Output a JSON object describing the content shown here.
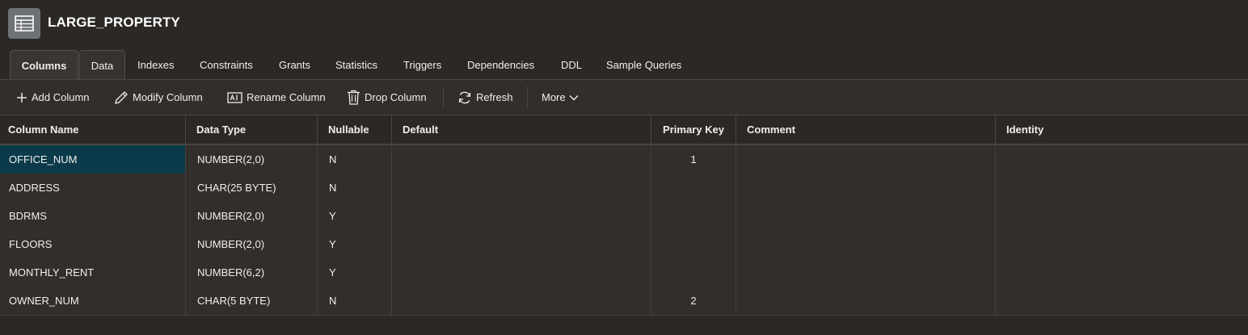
{
  "header": {
    "title": "LARGE_PROPERTY",
    "icon": "table-icon"
  },
  "tabs": [
    {
      "label": "Columns",
      "active": true
    },
    {
      "label": "Data"
    },
    {
      "label": "Indexes"
    },
    {
      "label": "Constraints"
    },
    {
      "label": "Grants"
    },
    {
      "label": "Statistics"
    },
    {
      "label": "Triggers"
    },
    {
      "label": "Dependencies"
    },
    {
      "label": "DDL"
    },
    {
      "label": "Sample Queries"
    }
  ],
  "toolbar": {
    "add_column": "Add Column",
    "modify_column": "Modify Column",
    "rename_column": "Rename Column",
    "drop_column": "Drop Column",
    "refresh": "Refresh",
    "more": "More"
  },
  "grid": {
    "headers": [
      "Column Name",
      "Data Type",
      "Nullable",
      "Default",
      "Primary Key",
      "Comment",
      "Identity"
    ],
    "rows": [
      [
        "OFFICE_NUM",
        "NUMBER(2,0)",
        "N",
        "",
        "1",
        "",
        ""
      ],
      [
        "ADDRESS",
        "CHAR(25 BYTE)",
        "N",
        "",
        "",
        "",
        ""
      ],
      [
        "BDRMS",
        "NUMBER(2,0)",
        "Y",
        "",
        "",
        "",
        ""
      ],
      [
        "FLOORS",
        "NUMBER(2,0)",
        "Y",
        "",
        "",
        "",
        ""
      ],
      [
        "MONTHLY_RENT",
        "NUMBER(6,2)",
        "Y",
        "",
        "",
        "",
        ""
      ],
      [
        "OWNER_NUM",
        "CHAR(5 BYTE)",
        "N",
        "",
        "2",
        "",
        ""
      ]
    ]
  },
  "colors": {
    "background": "#2b2825",
    "toolbar": "#312e2b",
    "selected_cell": "#0b3a4a",
    "text": "#f1efed"
  }
}
